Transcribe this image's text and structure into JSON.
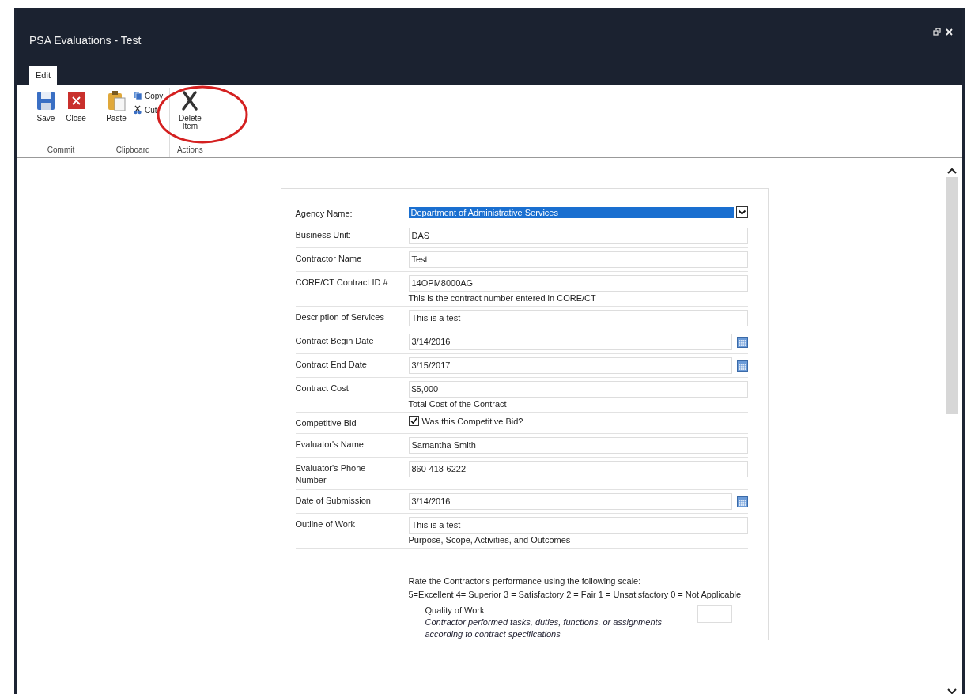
{
  "window": {
    "title": "PSA Evaluations - Test"
  },
  "ribbon": {
    "tabs": [
      {
        "label": "Edit",
        "selected": true
      }
    ],
    "groups": [
      {
        "label": "Commit",
        "buttons": [
          {
            "label": "Save",
            "kind": "save"
          },
          {
            "label": "Close",
            "kind": "close"
          }
        ]
      },
      {
        "label": "Clipboard",
        "buttons": [
          {
            "label": "Paste",
            "kind": "paste"
          },
          {
            "label": "Copy",
            "kind": "copy"
          },
          {
            "label": "Cut",
            "kind": "cut"
          }
        ]
      },
      {
        "label": "Actions",
        "buttons": [
          {
            "label": "Delete Item",
            "kind": "delete"
          }
        ]
      }
    ]
  },
  "annotation": {
    "kind": "circle",
    "color": "#d42020"
  },
  "form": {
    "rows": [
      {
        "kind": "dropdown",
        "label": "Agency Name:",
        "value": "Department of Administrative Services",
        "highlighted": true
      },
      {
        "kind": "text",
        "label": "Business Unit:",
        "value": "DAS"
      },
      {
        "kind": "text",
        "label": "Contractor Name",
        "value": "Test"
      },
      {
        "kind": "text",
        "label": "CORE/CT Contract ID #",
        "value": "14OPM8000AG",
        "hint": "This is the contract number entered in CORE/CT"
      },
      {
        "kind": "text",
        "label": "Description of Services",
        "value": "This is a test"
      },
      {
        "kind": "date",
        "label": "Contract Begin Date",
        "value": "3/14/2016"
      },
      {
        "kind": "date",
        "label": "Contract End Date",
        "value": "3/15/2017"
      },
      {
        "kind": "text",
        "label": "Contract Cost",
        "value": "$5,000",
        "hint": "Total Cost of the Contract"
      },
      {
        "kind": "checkbox",
        "label": "Competitive Bid",
        "text": "Was this Competitive Bid?",
        "checked": true
      },
      {
        "kind": "text",
        "label": "Evaluator's Name",
        "value": "Samantha Smith"
      },
      {
        "kind": "text",
        "label": "Evaluator's Phone Number",
        "value": "860-418-6222"
      },
      {
        "kind": "date",
        "label": "Date of Submission",
        "value": "3/14/2016"
      },
      {
        "kind": "text",
        "label": "Outline of Work",
        "value": "This is a test",
        "hint": "Purpose, Scope, Activities, and Outcomes"
      }
    ],
    "rating": {
      "intro": "Rate the Contractor's performance using the following scale:",
      "scale": "5=Excellent  4= Superior  3 = Satisfactory 2 = Fair  1 = Unsatisfactory  0 = Not Applicable",
      "criteria": [
        {
          "title": "Quality of Work",
          "description": "Contractor performed tasks, duties, functions, or assignments according to contract specifications"
        }
      ]
    }
  }
}
